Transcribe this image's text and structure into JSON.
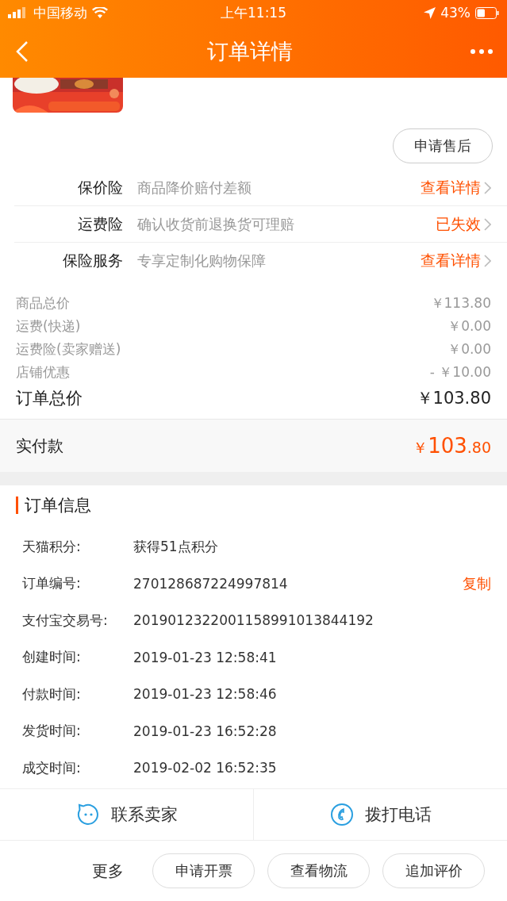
{
  "status_bar": {
    "carrier": "中国移动",
    "time": "上午11:15",
    "battery": "43%"
  },
  "nav": {
    "title": "订单详情"
  },
  "after_sale_button": "申请售后",
  "services": [
    {
      "name": "保价险",
      "desc": "商品降价赔付差额",
      "action": "查看详情"
    },
    {
      "name": "运费险",
      "desc": "确认收货前退换货可理赔",
      "action": "已失效"
    },
    {
      "name": "保险服务",
      "desc": "专享定制化购物保障",
      "action": "查看详情"
    }
  ],
  "price_lines": [
    {
      "label": "商品总价",
      "value": "￥113.80"
    },
    {
      "label": "运费(快递)",
      "value": "￥0.00"
    },
    {
      "label": "运费险(卖家赠送)",
      "value": "￥0.00"
    },
    {
      "label": "店铺优惠",
      "value": "- ￥10.00"
    }
  ],
  "order_total": {
    "label": "订单总价",
    "value": "￥103.80"
  },
  "paid": {
    "label": "实付款",
    "currency": "￥",
    "integer": "103",
    "decimal": ".80"
  },
  "order_info": {
    "title": "订单信息",
    "rows": [
      {
        "label": "天猫积分:",
        "value": "获得51点积分"
      },
      {
        "label": "订单编号:",
        "value": "270128687224997814",
        "action": "复制"
      },
      {
        "label": "支付宝交易号:",
        "value": "2019012322001158991013844192"
      },
      {
        "label": "创建时间:",
        "value": "2019-01-23 12:58:41"
      },
      {
        "label": "付款时间:",
        "value": "2019-01-23 12:58:46"
      },
      {
        "label": "发货时间:",
        "value": "2019-01-23 16:52:28"
      },
      {
        "label": "成交时间:",
        "value": "2019-02-02 16:52:35"
      }
    ]
  },
  "contact": [
    {
      "kind": "chat",
      "label": "联系卖家"
    },
    {
      "kind": "phone",
      "label": "拨打电话"
    }
  ],
  "more": {
    "label": "更多",
    "buttons": [
      "申请开票",
      "查看物流",
      "追加评价"
    ]
  }
}
